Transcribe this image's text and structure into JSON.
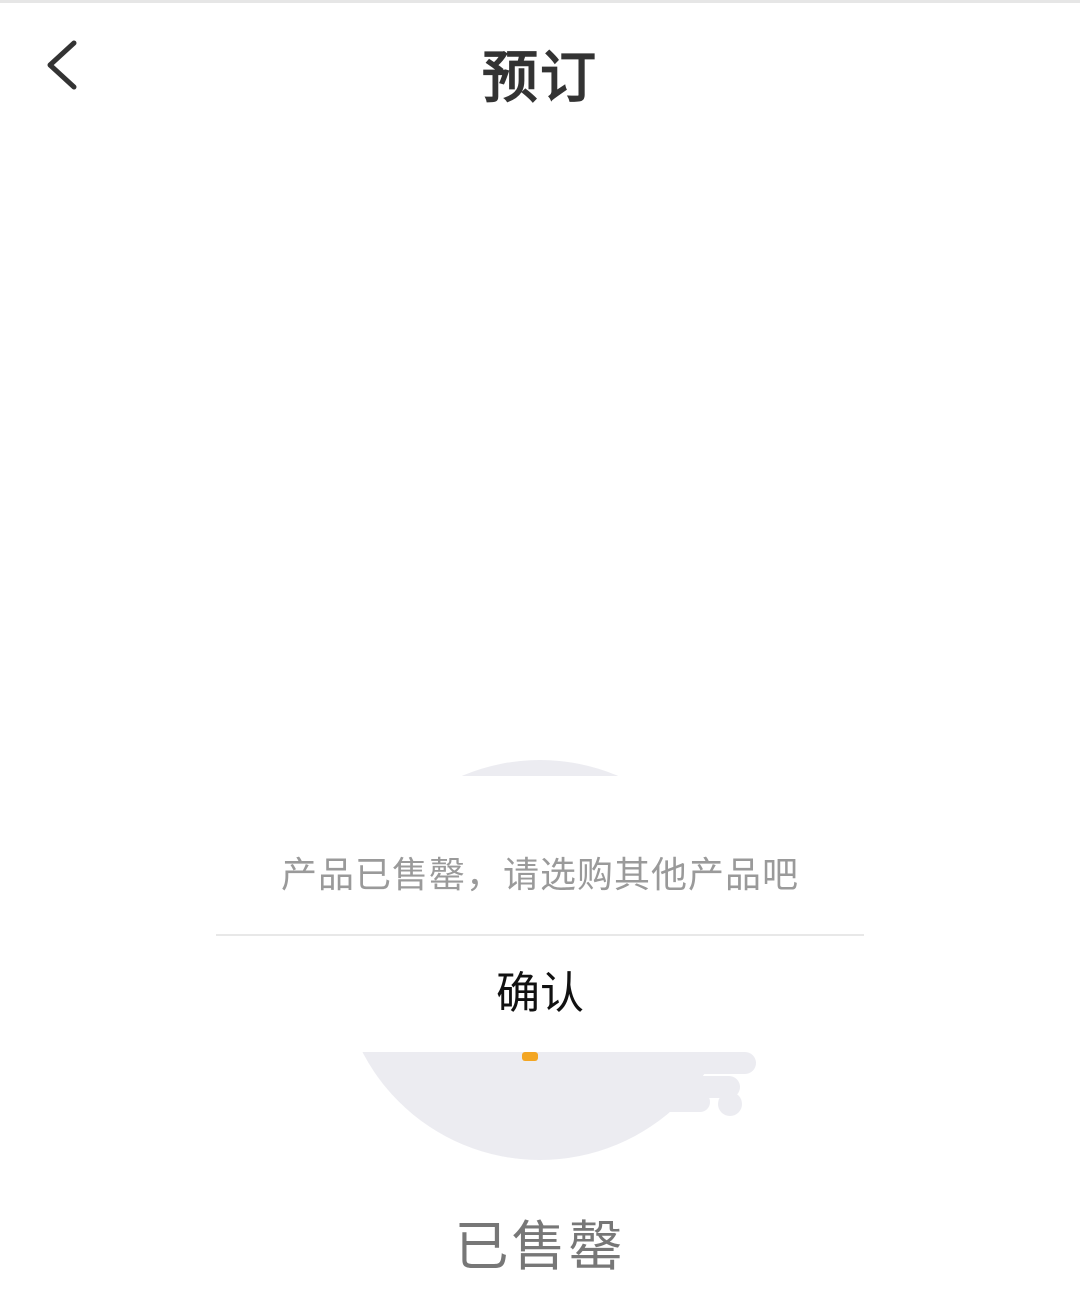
{
  "header": {
    "back_icon": "chevron-left-icon",
    "title": "预订"
  },
  "dialog": {
    "message": "产品已售罄，请选购其他产品吧",
    "confirm_label": "确认"
  },
  "empty_state": {
    "illustration_icon": "empty-box-icon",
    "label": "已售罄"
  },
  "colors": {
    "illustration_gray": "#ECECF1",
    "accent_orange": "#F3A623",
    "title_text": "#333333",
    "muted_text": "#9A9A9A"
  }
}
